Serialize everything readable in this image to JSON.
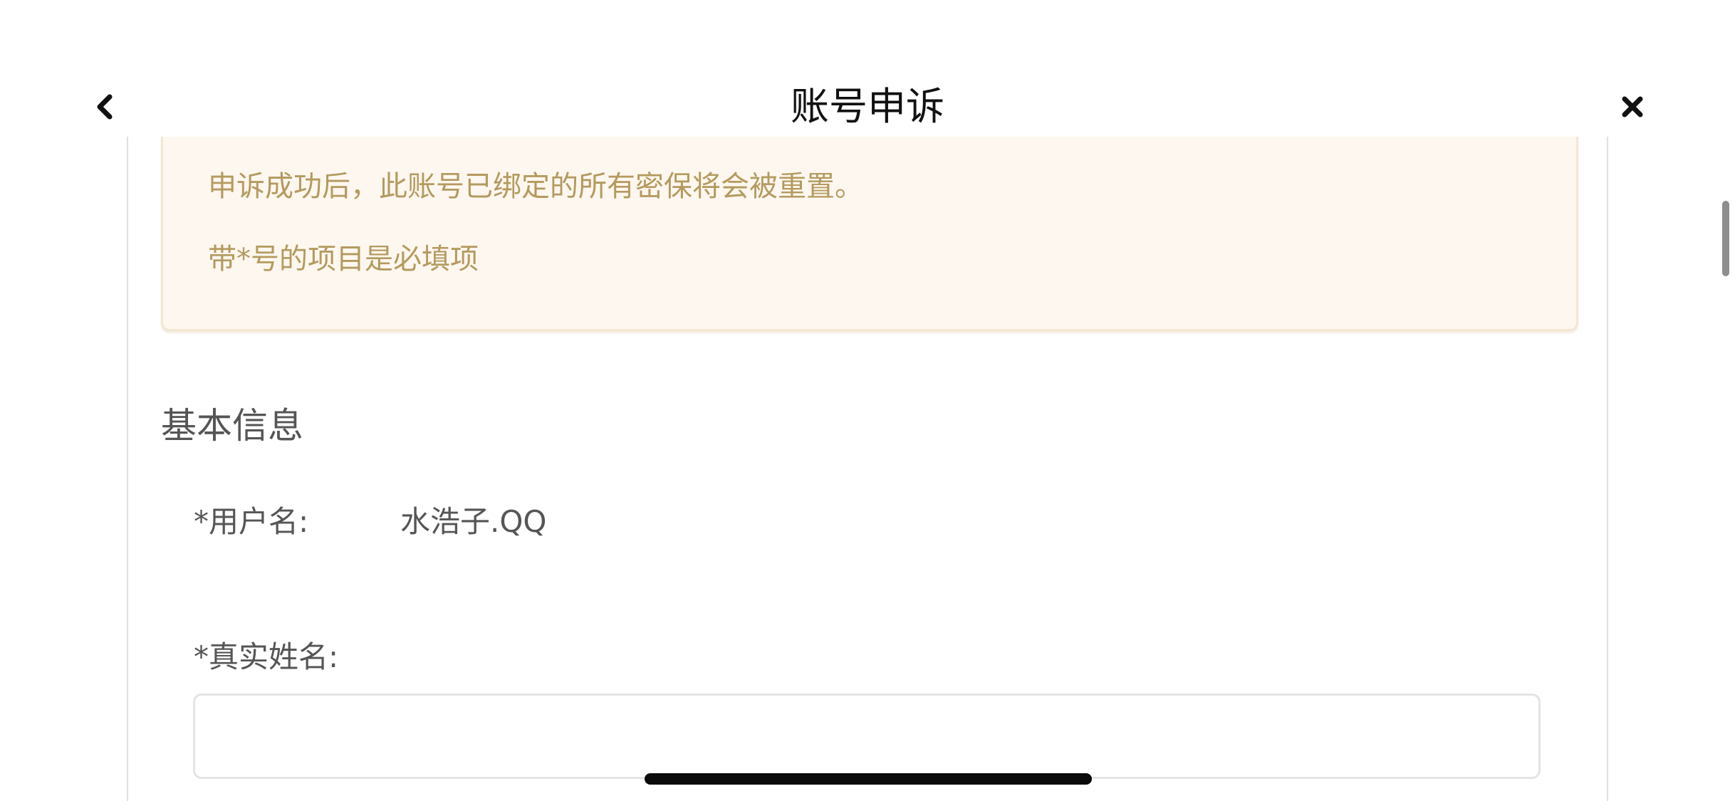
{
  "nav": {
    "title": "账号申诉",
    "back_icon": "chevron-left-icon",
    "close_icon": "close-icon"
  },
  "notice": {
    "line1": "申诉成功后，此账号已绑定的所有密保将会被重置。",
    "line2": "带*号的项目是必填项"
  },
  "basic_info": {
    "section_title": "基本信息",
    "username_label": "*用户名:",
    "username_value": "水浩子.QQ",
    "realname_label": "*真实姓名:",
    "realname_value": "",
    "realname_placeholder": ""
  },
  "colors": {
    "notice_text": "#b59a5e",
    "notice_bg": "#fdf7ef",
    "label_text": "#555555",
    "title_text": "#111111"
  }
}
